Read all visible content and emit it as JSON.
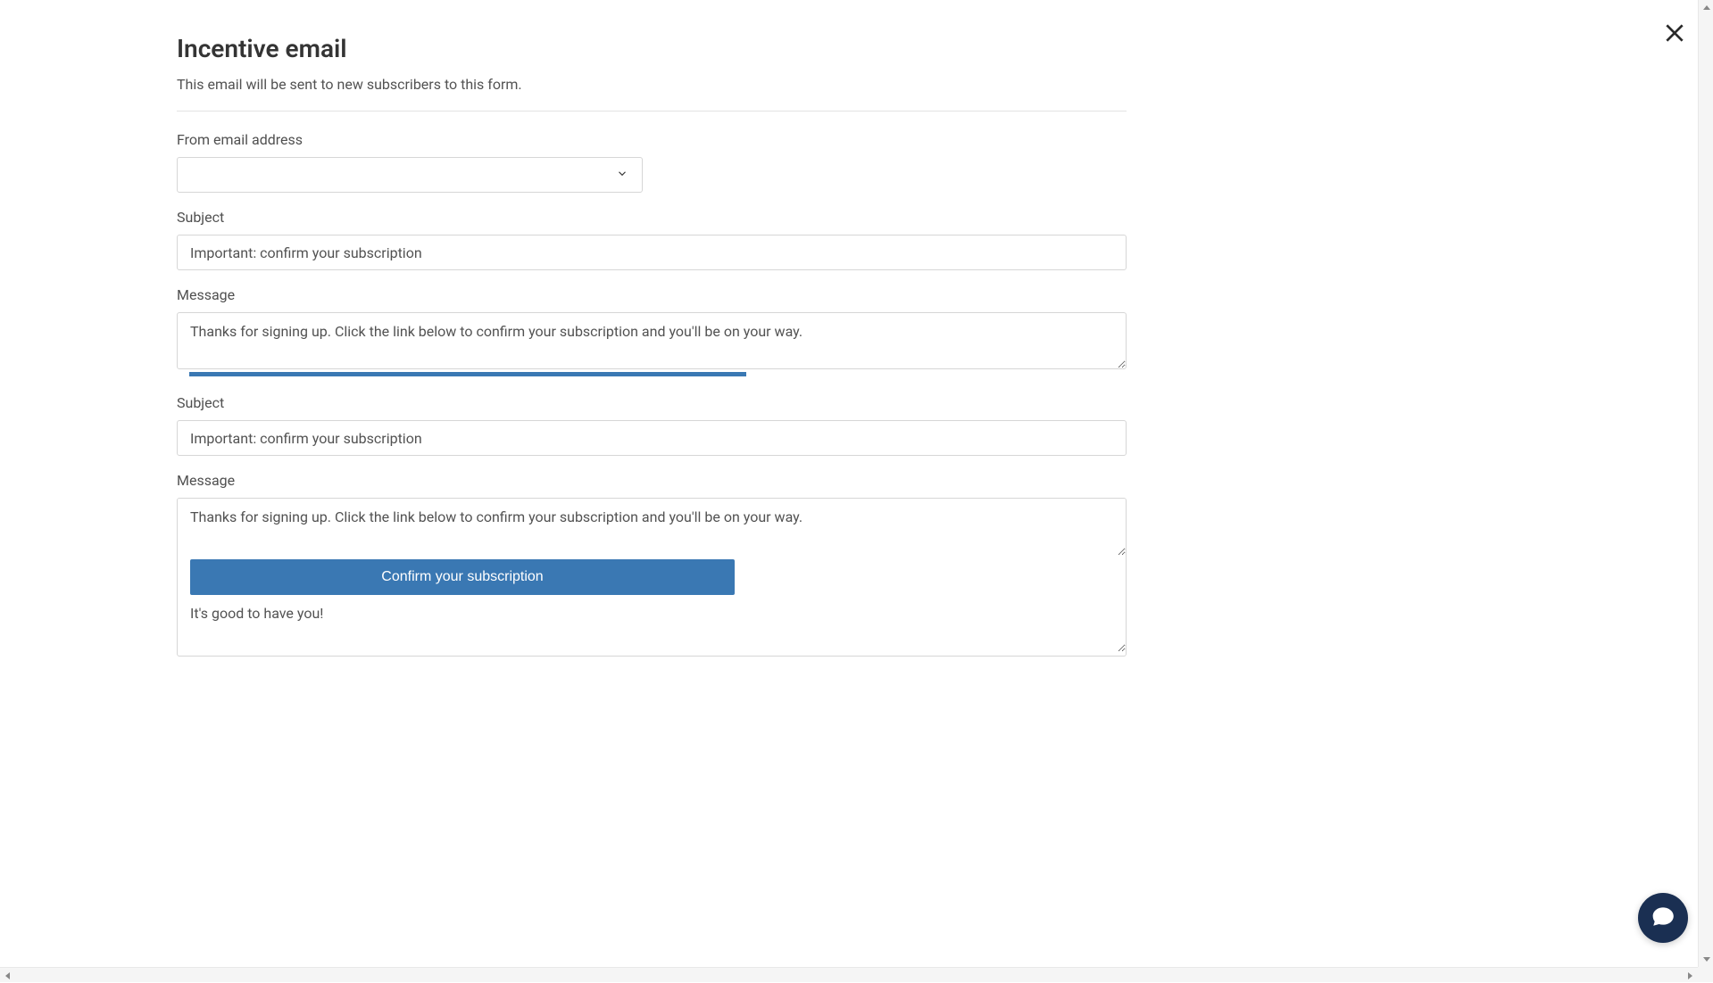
{
  "header": {
    "title": "Incentive email",
    "subtitle": "This email will be sent to new subscribers to this form."
  },
  "form": {
    "from_email": {
      "label": "From email address",
      "value": ""
    },
    "subject1": {
      "label": "Subject",
      "value": "Important: confirm your subscription"
    },
    "message1": {
      "label": "Message",
      "value": "Thanks for signing up. Click the link below to confirm your subscription and you'll be on your way."
    },
    "subject2": {
      "label": "Subject",
      "value": "Important: confirm your subscription"
    },
    "message2": {
      "label": "Message",
      "top_text": "Thanks for signing up. Click the link below to confirm your subscription and you'll be on your way.",
      "button_label": "Confirm your subscription",
      "bottom_text": "It's good to have you!"
    }
  }
}
